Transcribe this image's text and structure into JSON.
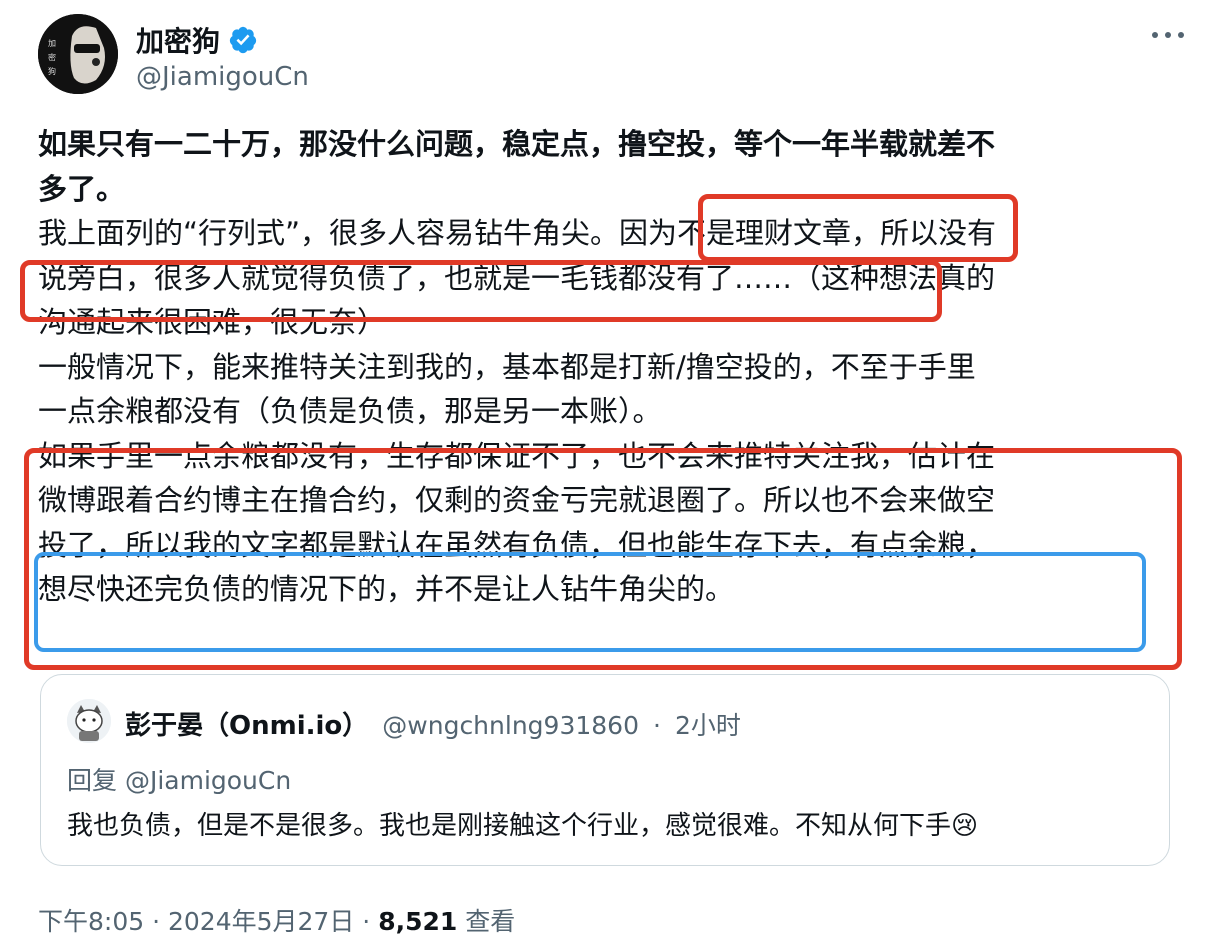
{
  "author": {
    "display_name": "加密狗",
    "handle": "@JiamigouCn",
    "avatar_text": "加密狗"
  },
  "post": {
    "lines": [
      "如果只有一二十万，那没什么问题，稳定点，撸空投，等个一年半载就差不",
      "多了。",
      "我上面列的“行列式”，很多人容易钻牛角尖。因为不是理财文章，所以没有",
      "说旁白，很多人就觉得负债了，也就是一毛钱都没有了……（这种想法真的",
      "沟通起来很困难，很无奈）",
      "一般情况下，能来推特关注到我的，基本都是打新/撸空投的，不至于手里",
      "一点余粮都没有（负债是负债，那是另一本账）。",
      "如果手里一点余粮都没有，生存都保证不了，也不会来推特关注我，估计在",
      "微博跟着合约博主在撸合约，仅剩的资金亏完就退圈了。所以也不会来做空",
      "投了，所以我的文字都是默认在虽然有负债，但也能生存下去，有点余粮，",
      "想尽快还完负债的情况下的，并不是让人钻牛角尖的。"
    ]
  },
  "quoted": {
    "display_name": "彭于晏（Onmi.io）",
    "handle": "@wngchnlng931860",
    "separator": "·",
    "time": "2小时",
    "reply_to": "回复 @JiamigouCn",
    "text": "我也负债，但是不是很多。我也是刚接触这个行业，感觉很难。不知从何下手",
    "emoji": "😢"
  },
  "footer": {
    "time": "下午8:05",
    "sep1": "·",
    "date": "2024年5月27日",
    "sep2": "·",
    "views_count": "8,521",
    "views_label": "查看"
  },
  "colors": {
    "highlight_red": "#e03a27",
    "highlight_blue": "#3b9bea",
    "verified_blue": "#1d9bf0",
    "secondary_text": "#536471"
  },
  "icons": {
    "verified": "verified-badge-icon",
    "more": "more-dots-icon"
  }
}
